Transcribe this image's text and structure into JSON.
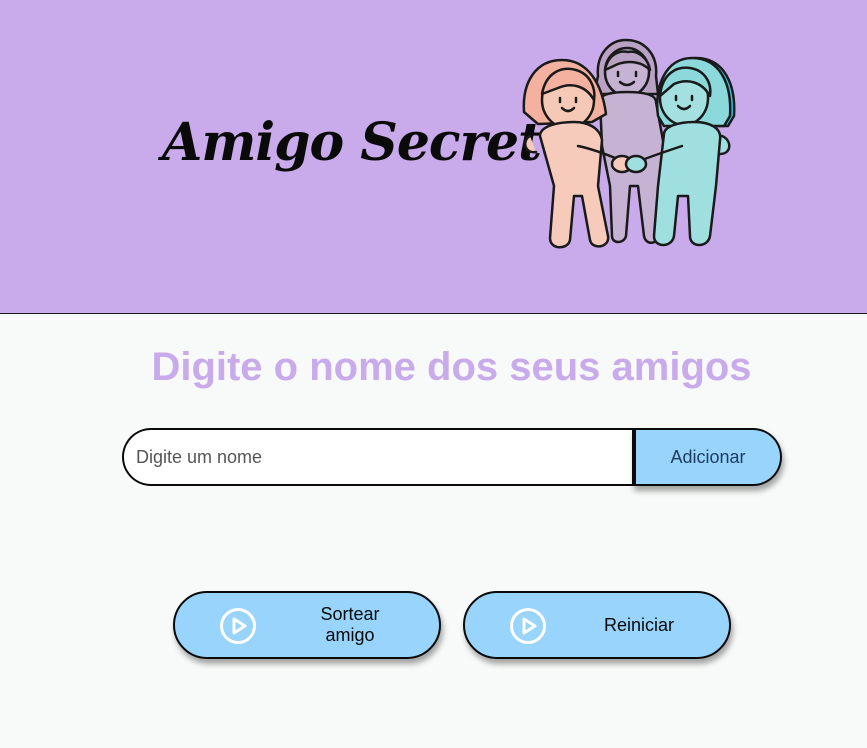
{
  "header": {
    "title": "Amigo Secreto",
    "illustration": "three-friends-hugging-illustration"
  },
  "main": {
    "heading": "Digite o nome dos seus amigos",
    "input": {
      "value": "",
      "placeholder": "Digite um nome"
    },
    "add_button_label": "Adicionar",
    "draw_button_label": "Sortear amigo",
    "reset_button_label": "Reiniciar",
    "button_icon": "play-circle-icon"
  },
  "colors": {
    "header_bg": "#c9abeb",
    "heading": "#c9abeb",
    "button_bg": "#98d4fb",
    "page_bg": "#f8faf9"
  }
}
